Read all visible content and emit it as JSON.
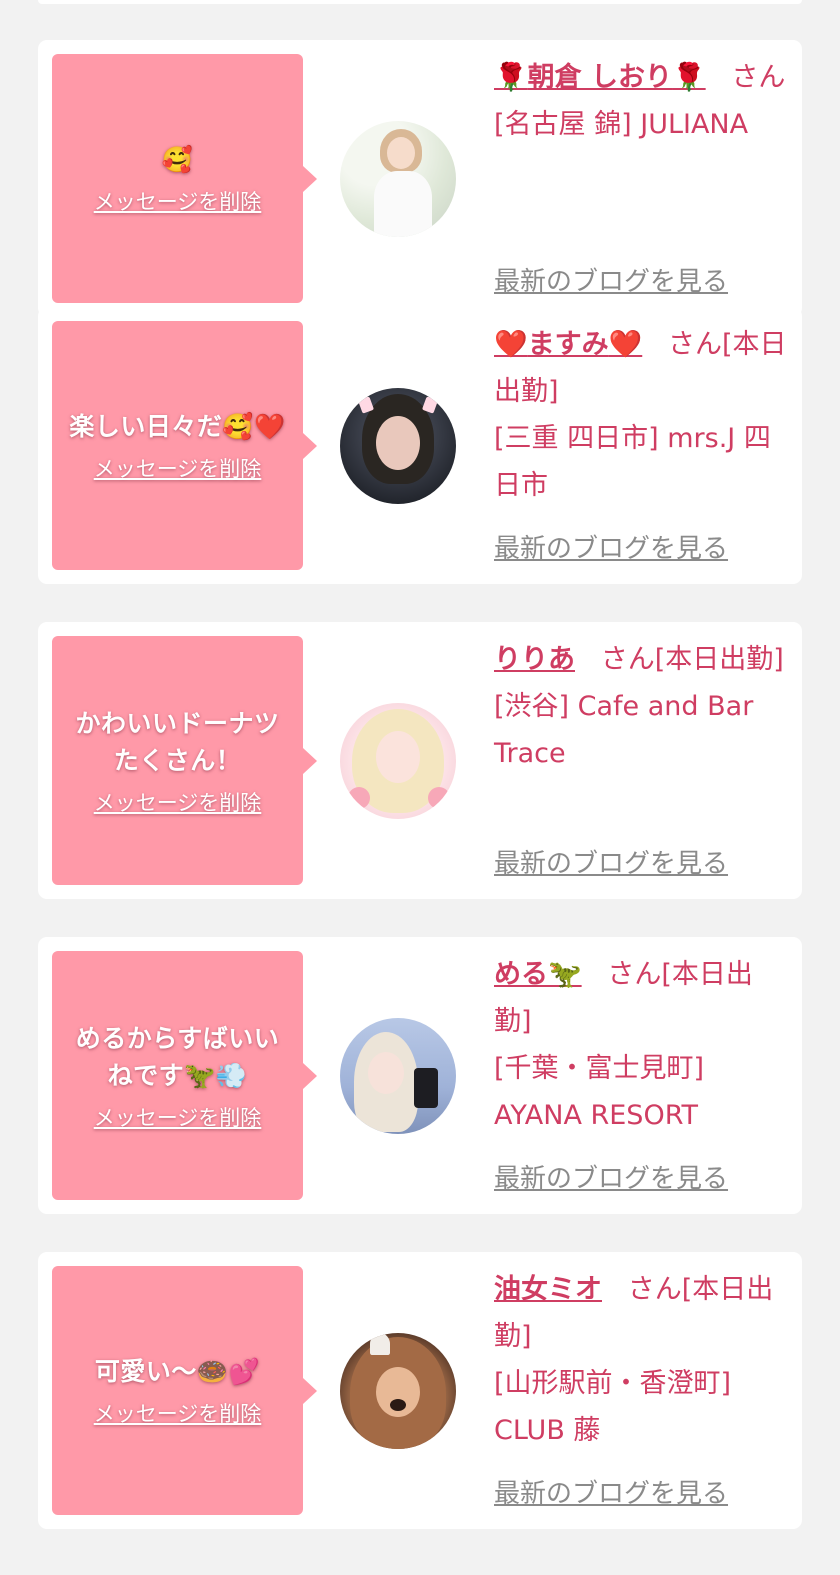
{
  "cards": [
    {
      "message": "🥰",
      "delete_label": "メッセージを削除",
      "name_prefix": "🌹",
      "name": "朝倉 しおり",
      "name_suffix": "🌹",
      "san": "さん",
      "shop": "[名古屋 錦] JULIANA",
      "blog_label": "最新のブログを見る"
    },
    {
      "message": "楽しい日々だ🥰❤️",
      "delete_label": "メッセージを削除",
      "name_prefix": "❤️",
      "name": "ますみ",
      "name_suffix": "❤️",
      "san": "さん[本日出勤]",
      "shop": "[三重 四日市] mrs.J 四日市",
      "blog_label": "最新のブログを見る"
    },
    {
      "message": "かわいいドーナツ\nたくさん！",
      "delete_label": "メッセージを削除",
      "name_prefix": "",
      "name": "りりあ",
      "name_suffix": "",
      "san": "さん[本日出勤]",
      "shop": "[渋谷] Cafe and Bar Trace",
      "blog_label": "最新のブログを見る"
    },
    {
      "message": "めるからすばいい\nねです🦖💨",
      "delete_label": "メッセージを削除",
      "name_prefix": "",
      "name": "める🦖",
      "name_suffix": "",
      "san": "さん[本日出勤]",
      "shop": "[千葉・富士見町] AYANA RESORT",
      "blog_label": "最新のブログを見る"
    },
    {
      "message": "可愛い〜🍩💕",
      "delete_label": "メッセージを削除",
      "name_prefix": "",
      "name": "油女ミオ",
      "name_suffix": "",
      "san": "さん[本日出勤]",
      "shop": "[山形駅前・香澄町] CLUB 藤",
      "blog_label": "最新のブログを見る"
    }
  ]
}
